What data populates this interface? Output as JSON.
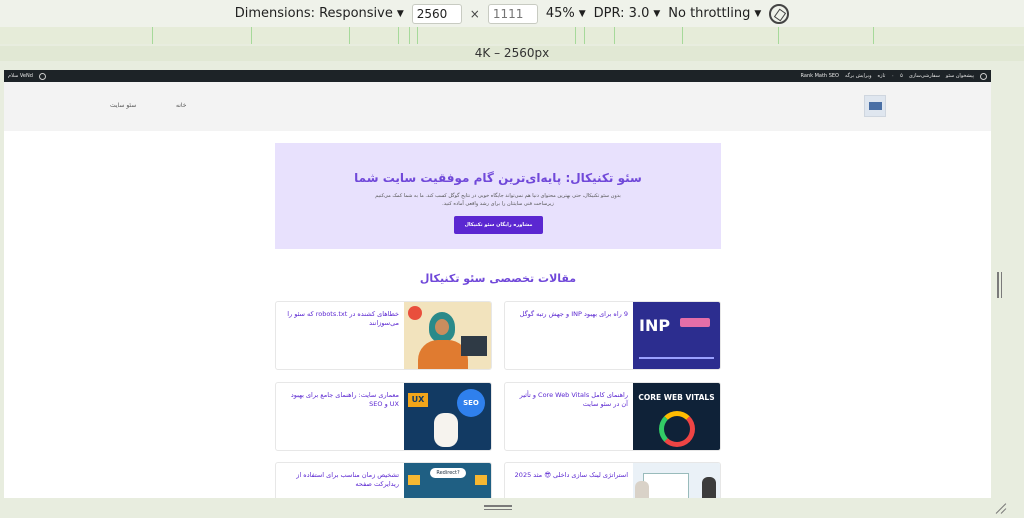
{
  "devtools": {
    "dimensions_label": "Dimensions: Responsive",
    "width_value": "2560",
    "height_placeholder": "1111",
    "zoom": "45%",
    "dpr": "DPR: 3.0",
    "throttling": "No throttling",
    "times": "×",
    "breakpoint_label": "4K – 2560px"
  },
  "admin_bar": {
    "left_text": "سلام VeNd",
    "right_items": [
      "پیشخوان سئو",
      "سفارشی‌سازی",
      "۵",
      "۰",
      "تازه",
      "ویرایش برگه",
      "Rank Math SEO"
    ]
  },
  "nav": {
    "home": "خانه",
    "seo_site": "سئو سایت"
  },
  "hero": {
    "title": "سئو تکنیکال: پایه‌ای‌ترین گام موفقیت سایت شما",
    "text": "بدون سئو تکنیکال، حتی بهترین محتوای دنیا هم نمی‌تواند جایگاه خوبی در نتایج گوگل کسب کند. ما به شما کمک می‌کنیم زیرساخت فنی سایتتان را برای رشد واقعی آماده کنید.",
    "button": "مشاوره رایگان سئو تکنیکال"
  },
  "section_title": "مقالات تخصصی سئو تکنیکال",
  "articles": [
    {
      "title": "9 راه برای بهبود INP و جهش رتبه گوگل",
      "image": "inp-illustration"
    },
    {
      "title": "خطاهای کشنده در robots.txt که سئو را می‌سوزانند",
      "image": "woman-laptop-illustration"
    },
    {
      "title": "راهنمای کامل Core Web Vitals و تأثیر آن در سئو سایت",
      "image": "core-web-vitals-gauge",
      "image_text": "CORE WEB VITALS"
    },
    {
      "title": "معماری سایت: راهنمای جامع برای بهبود UX و SEO",
      "image": "ux-seo-illustration",
      "ux_text": "UX",
      "seo_text": "SEO"
    },
    {
      "title": "استراتژی لینک سازی داخلی 😎 مثد 2025",
      "image": "people-window-illustration"
    },
    {
      "title": "تشخیص زمان مناسب برای استفاده از ریدایرکت صفحه",
      "image": "redirect-flowchart",
      "redirect_text": "Redirect?"
    }
  ],
  "inp_text": "INP"
}
